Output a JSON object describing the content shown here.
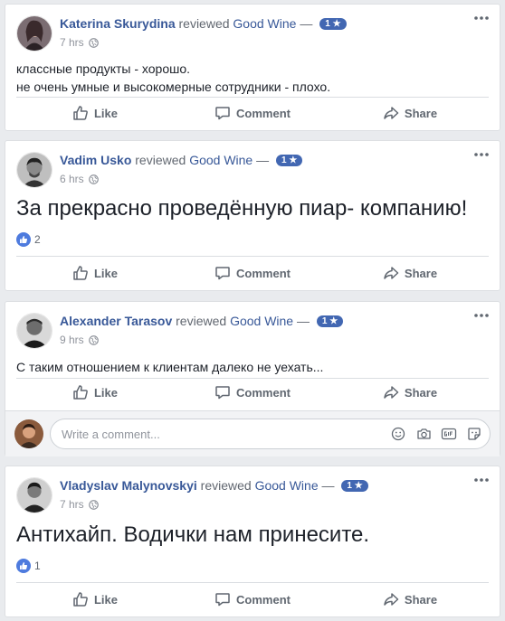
{
  "reviews": [
    {
      "author": "Katerina Skurydina",
      "verb": "reviewed",
      "page": "Good Wine",
      "dash": "—",
      "rating": "1 ★",
      "time": "7 hrs",
      "text_line1": "классные продукты - хорошо.",
      "text_line2": "не очень умные и высокомерные сотрудники - плохо.",
      "actions": {
        "like": "Like",
        "comment": "Comment",
        "share": "Share"
      }
    },
    {
      "author": "Vadim Usko",
      "verb": "reviewed",
      "page": "Good Wine",
      "dash": "—",
      "rating": "1 ★",
      "time": "6 hrs",
      "text": "За прекрасно проведённую пиар- компанию!",
      "likes": "2",
      "actions": {
        "like": "Like",
        "comment": "Comment",
        "share": "Share"
      }
    },
    {
      "author": "Alexander Tarasov",
      "verb": "reviewed",
      "page": "Good Wine",
      "dash": "—",
      "rating": "1 ★",
      "time": "9 hrs",
      "text": "С таким отношением к клиентам далеко не уехать...",
      "actions": {
        "like": "Like",
        "comment": "Comment",
        "share": "Share"
      },
      "comment_placeholder": "Write a comment..."
    },
    {
      "author": "Vladyslav Malynovskyi",
      "verb": "reviewed",
      "page": "Good Wine",
      "dash": "—",
      "rating": "1 ★",
      "time": "7 hrs",
      "text": "Антихайп. Водички нам принесите.",
      "likes": "1",
      "actions": {
        "like": "Like",
        "comment": "Comment",
        "share": "Share"
      }
    }
  ],
  "colors": {
    "link": "#385898",
    "badge": "#4267b2",
    "background": "#e9ebee"
  },
  "icons": [
    "more-icon",
    "globe-icon",
    "like-icon",
    "comment-icon",
    "share-icon",
    "emoji-icon",
    "camera-icon",
    "gif-icon",
    "sticker-icon"
  ]
}
